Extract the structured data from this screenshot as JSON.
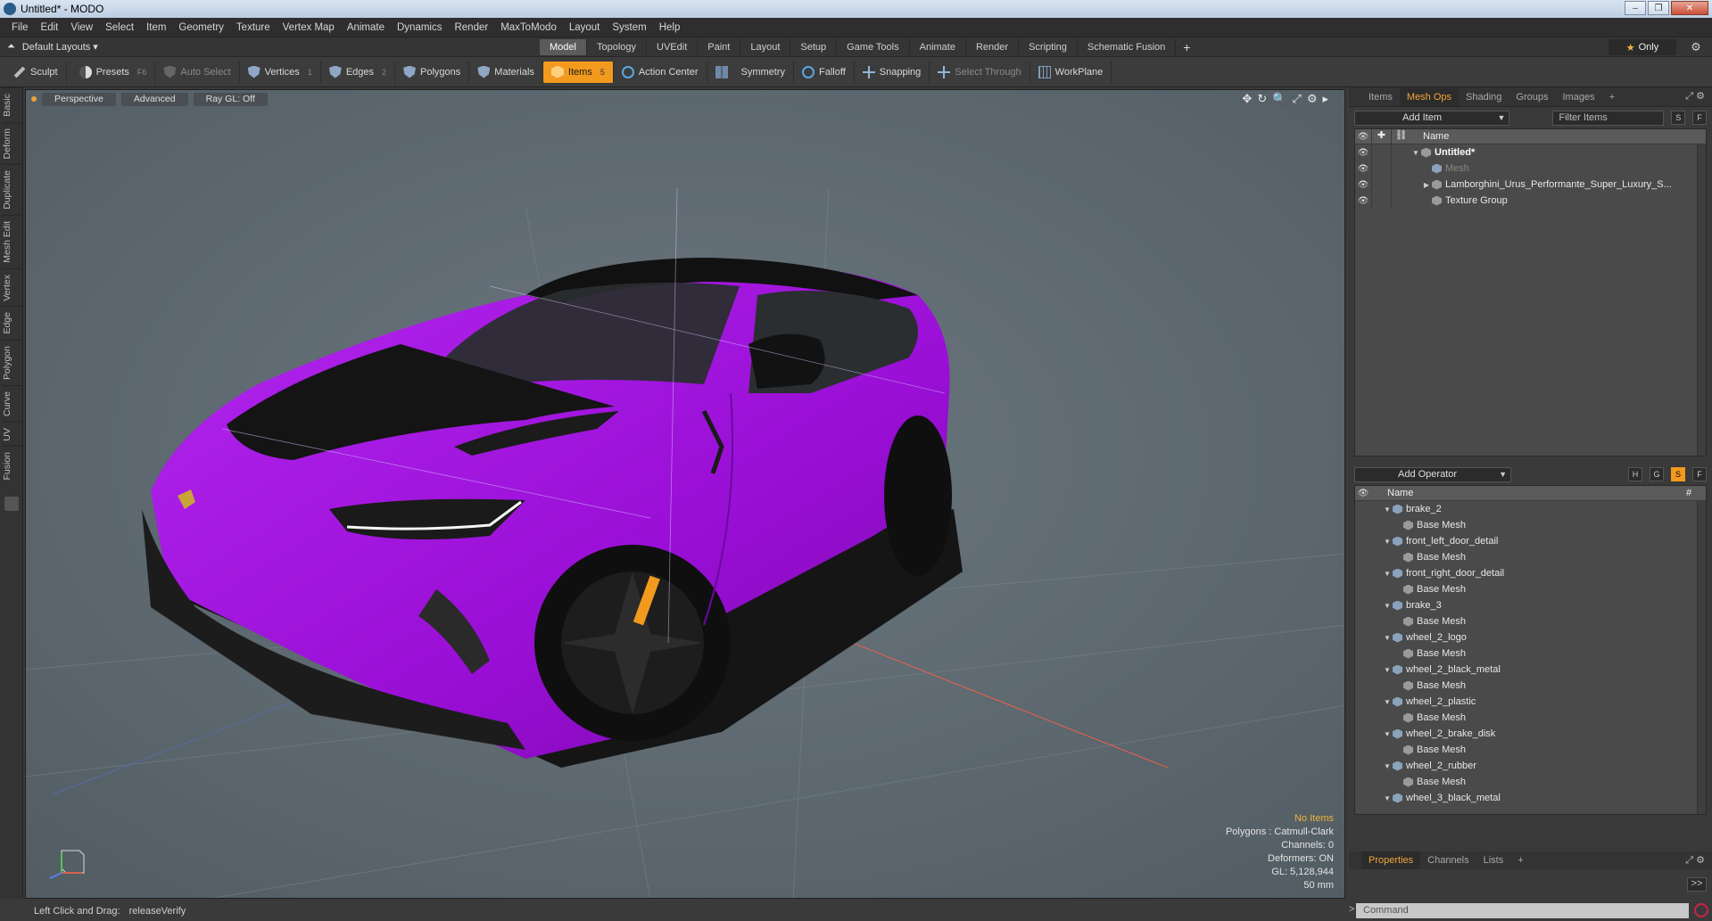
{
  "window": {
    "title": "Untitled* - MODO",
    "controls": [
      "–",
      "❐",
      "✕"
    ]
  },
  "menu": [
    "File",
    "Edit",
    "View",
    "Select",
    "Item",
    "Geometry",
    "Texture",
    "Vertex Map",
    "Animate",
    "Dynamics",
    "Render",
    "MaxToModo",
    "Layout",
    "System",
    "Help"
  ],
  "layout_bar": {
    "dropdown_label": "Default Layouts ▾",
    "tabs": [
      "Model",
      "Topology",
      "UVEdit",
      "Paint",
      "Layout",
      "Setup",
      "Game Tools",
      "Animate",
      "Render",
      "Scripting",
      "Schematic Fusion"
    ],
    "active_tab": "Model",
    "plus": "+",
    "only_label": "Only",
    "star": "★"
  },
  "toolbar": {
    "sculpt": "Sculpt",
    "presets": "Presets",
    "presets_key": "F6",
    "auto_select": "Auto Select",
    "vertices": "Vertices",
    "vertices_key": "1",
    "edges": "Edges",
    "edges_key": "2",
    "polygons": "Polygons",
    "materials": "Materials",
    "items": "Items",
    "items_key": "5",
    "action_center": "Action Center",
    "symmetry": "Symmetry",
    "falloff": "Falloff",
    "snapping": "Snapping",
    "select_through": "Select Through",
    "workplane": "WorkPlane"
  },
  "left_tabs": [
    "Basic",
    "Deform",
    "Duplicate",
    "Mesh Edit",
    "Vertex",
    "Edge",
    "Polygon",
    "Curve",
    "UV",
    "Fusion"
  ],
  "viewport": {
    "perspective": "Perspective",
    "advanced": "Advanced",
    "raygl": "Ray GL: Off",
    "info": {
      "no_items": "No Items",
      "polygons": "Polygons : Catmull-Clark",
      "channels": "Channels: 0",
      "deformers": "Deformers: ON",
      "gl": "GL: 5,128,944",
      "mm": "50 mm"
    },
    "colors": {
      "background": "#5f6b73",
      "body": "#a310e0",
      "carbon": "#1c1c1c",
      "accent": "#f29a1e"
    }
  },
  "status": {
    "hint": "Left Click and Drag:",
    "action": "releaseVerify"
  },
  "items_panel": {
    "tabs": [
      "Items",
      "Mesh Ops",
      "Shading",
      "Groups",
      "Images",
      "+"
    ],
    "active_tab": "Mesh Ops",
    "add_item": "Add Item",
    "filter_placeholder": "Filter Items",
    "s": "S",
    "f": "F",
    "name_header": "Name",
    "rows": [
      {
        "label": "Untitled*",
        "level": 0,
        "bold": true
      },
      {
        "label": "Mesh",
        "level": 1,
        "dim": true
      },
      {
        "label": "Lamborghini_Urus_Performante_Super_Luxury_S...",
        "level": 1
      },
      {
        "label": "Texture Group",
        "level": 1
      }
    ]
  },
  "mesh_ops": {
    "add_operator": "Add Operator",
    "h": "H",
    "g": "G",
    "s": "S",
    "f": "F",
    "name_header": "Name",
    "hash_header": "#",
    "rows": [
      {
        "label": "brake_2",
        "level": 0
      },
      {
        "label": "Base Mesh",
        "level": 1
      },
      {
        "label": "front_left_door_detail",
        "level": 0
      },
      {
        "label": "Base Mesh",
        "level": 1
      },
      {
        "label": "front_right_door_detail",
        "level": 0
      },
      {
        "label": "Base Mesh",
        "level": 1
      },
      {
        "label": "brake_3",
        "level": 0
      },
      {
        "label": "Base Mesh",
        "level": 1
      },
      {
        "label": "wheel_2_logo",
        "level": 0
      },
      {
        "label": "Base Mesh",
        "level": 1
      },
      {
        "label": "wheel_2_black_metal",
        "level": 0
      },
      {
        "label": "Base Mesh",
        "level": 1
      },
      {
        "label": "wheel_2_plastic",
        "level": 0
      },
      {
        "label": "Base Mesh",
        "level": 1
      },
      {
        "label": "wheel_2_brake_disk",
        "level": 0
      },
      {
        "label": "Base Mesh",
        "level": 1
      },
      {
        "label": "wheel_2_rubber",
        "level": 0
      },
      {
        "label": "Base Mesh",
        "level": 1
      },
      {
        "label": "wheel_3_black_metal",
        "level": 0
      }
    ]
  },
  "properties": {
    "tabs": [
      "Properties",
      "Channels",
      "Lists",
      "+"
    ],
    "active_tab": "Properties",
    "expand": ">>",
    "command_placeholder": "Command",
    "prompt": ">"
  }
}
